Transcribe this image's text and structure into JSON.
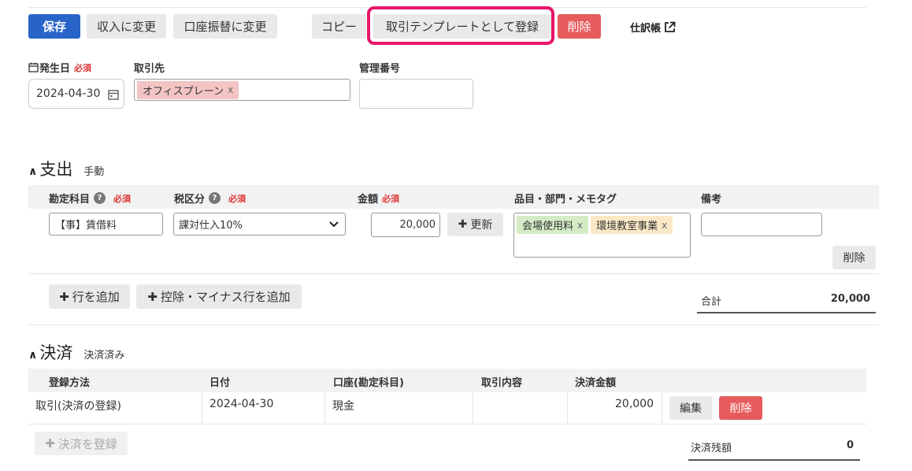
{
  "toolbar": {
    "save": "保存",
    "to_income": "収入に変更",
    "to_transfer": "口座振替に変更",
    "copy": "コピー",
    "register_template": "取引テンプレートとして登録",
    "delete": "削除",
    "journal": "仕訳帳"
  },
  "form": {
    "date_label": "発生日",
    "required": "必須",
    "date_value": "2024-04-30",
    "partner_label": "取引先",
    "partner_tag": "オフィスプレーン",
    "mgmt_label": "管理番号",
    "mgmt_value": ""
  },
  "expense": {
    "title": "支出",
    "mode": "手動",
    "headers": {
      "account": "勘定科目",
      "tax": "税区分",
      "amount": "金額",
      "tags": "品目・部門・メモタグ",
      "memo": "備考"
    },
    "row": {
      "account": "【事】賃借料",
      "tax": "課対仕入10%",
      "amount": "20,000",
      "update": "更新",
      "tags": [
        "会場使用料",
        "環境教室事業"
      ],
      "memo": "",
      "delete": "削除"
    },
    "add_row": "行を追加",
    "add_minus_row": "控除・マイナス行を追加",
    "total_label": "合計",
    "total_value": "20,000"
  },
  "settlement": {
    "title": "決済",
    "status": "決済済み",
    "headers": {
      "method": "登録方法",
      "date": "日付",
      "account": "口座(勘定科目)",
      "description": "取引内容",
      "amount": "決済金額"
    },
    "row": {
      "method": "取引(決済の登録)",
      "date": "2024-04-30",
      "account": "現金",
      "description": "",
      "amount": "20,000",
      "edit": "編集",
      "delete": "削除"
    },
    "register": "決済を登録",
    "balance_label": "決済残額",
    "balance_value": "0"
  }
}
